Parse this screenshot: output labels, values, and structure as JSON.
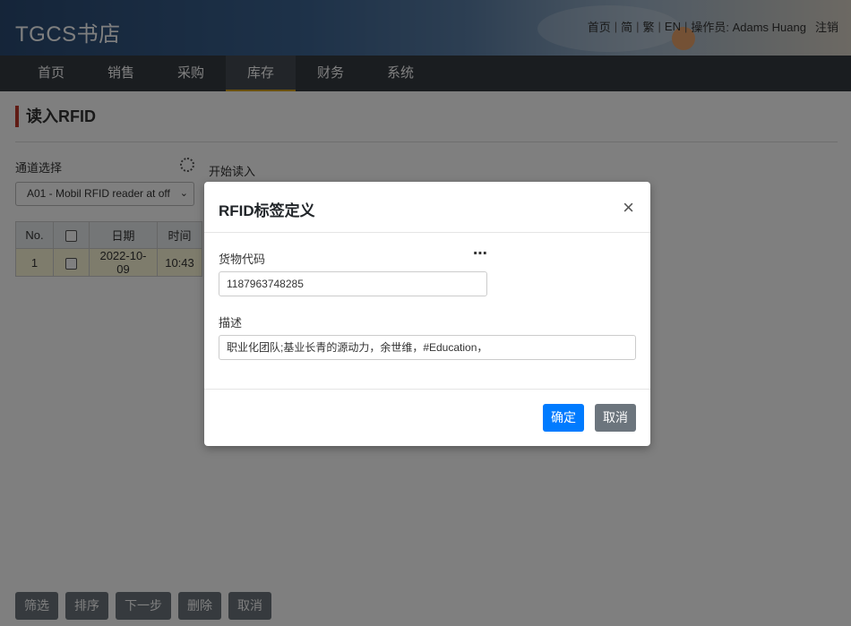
{
  "header": {
    "brand": "TGCS书店",
    "links": {
      "home": "首页",
      "simplified": "简",
      "traditional": "繁",
      "english": "EN",
      "operator": "操作员: Adams Huang",
      "logout": "注销"
    }
  },
  "nav": {
    "items": [
      {
        "label": "首页"
      },
      {
        "label": "销售"
      },
      {
        "label": "采购"
      },
      {
        "label": "库存"
      },
      {
        "label": "财务"
      },
      {
        "label": "系统"
      }
    ],
    "active": "库存"
  },
  "page": {
    "title": "读入RFID",
    "channel_label": "通道选择",
    "start_read": "开始读入",
    "channel_select": "A01 - Mobil RFID reader at off"
  },
  "table": {
    "headers": [
      "No.",
      "",
      "日期",
      "时间"
    ],
    "rows": [
      {
        "no": "1",
        "date": "2022-10-09",
        "time": "10:43"
      }
    ]
  },
  "bottom_buttons": [
    "筛选",
    "排序",
    "下一步",
    "删除",
    "取消"
  ],
  "modal": {
    "title": "RFID标签定义",
    "close": "×",
    "goods_code_label": "货物代码",
    "goods_code_value": "1187963748285",
    "desc_label": "描述",
    "desc_value": "职业化团队;基业长青的源动力，余世维，#Education，",
    "ok": "确定",
    "cancel": "取消"
  },
  "colors": {
    "navbar": "#343a40",
    "active_underline": "#d4a017",
    "title_bar": "#c0392b",
    "primary": "#007bff",
    "secondary": "#6c757d",
    "row_highlight": "#fcf8d8"
  }
}
